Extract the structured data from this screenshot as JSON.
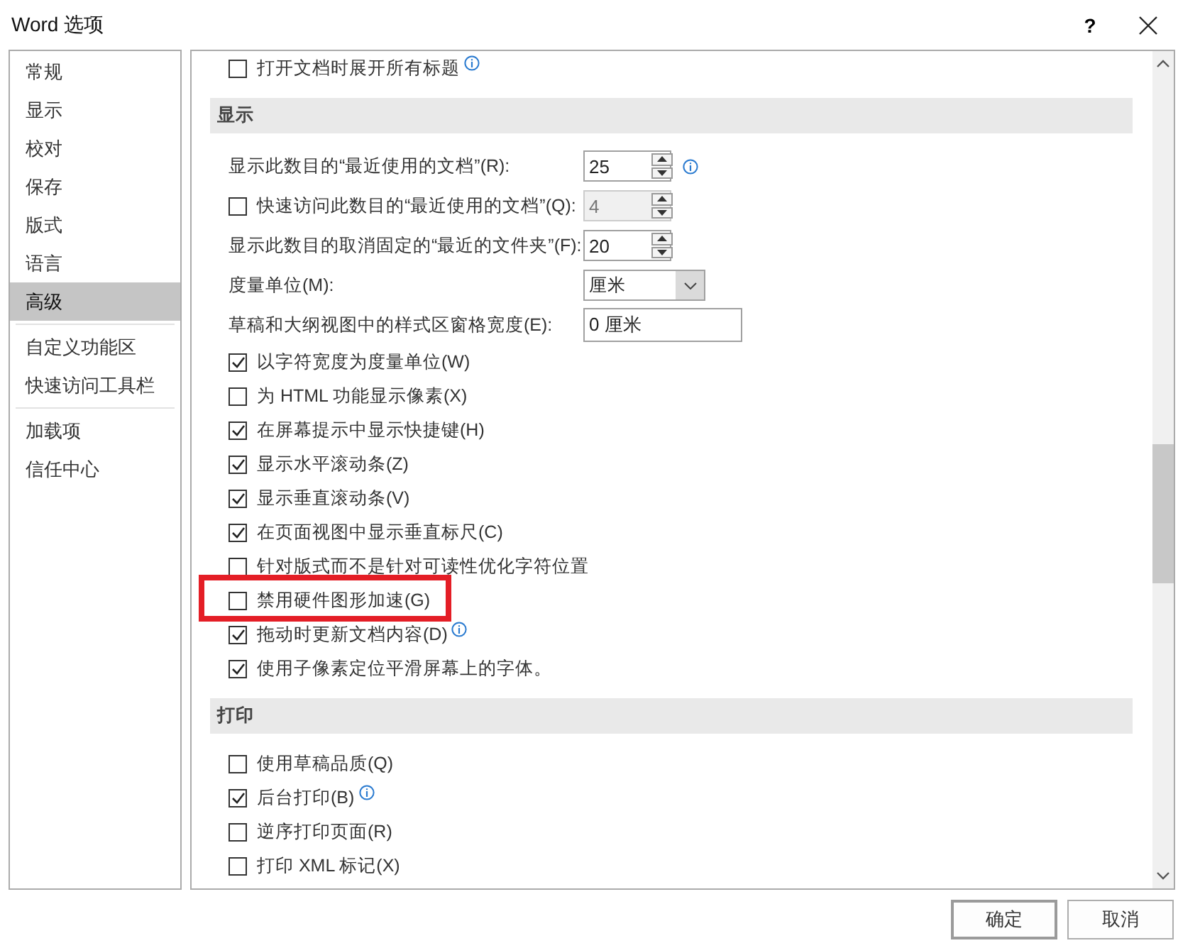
{
  "window": {
    "title": "Word 选项",
    "help": "?"
  },
  "sidebar": {
    "groups": [
      {
        "items": [
          {
            "label": "常规",
            "selected": false
          },
          {
            "label": "显示",
            "selected": false
          },
          {
            "label": "校对",
            "selected": false
          },
          {
            "label": "保存",
            "selected": false
          },
          {
            "label": "版式",
            "selected": false
          },
          {
            "label": "语言",
            "selected": false
          },
          {
            "label": "高级",
            "selected": true
          }
        ]
      },
      {
        "items": [
          {
            "label": "自定义功能区",
            "selected": false
          },
          {
            "label": "快速访问工具栏",
            "selected": false
          }
        ]
      },
      {
        "items": [
          {
            "label": "加载项",
            "selected": false
          },
          {
            "label": "信任中心",
            "selected": false
          }
        ]
      }
    ]
  },
  "sections": [
    {
      "items": [
        {
          "kind": "checkbox",
          "label": "打开文档时展开所有标题",
          "checked": false,
          "info": true
        }
      ]
    },
    {
      "title": "显示",
      "items": [
        {
          "kind": "spinner",
          "label": "显示此数目的“最近使用的文档”(R):",
          "value": "25",
          "info": true
        },
        {
          "kind": "check-spinner",
          "label": "快速访问此数目的“最近使用的文档”(Q):",
          "checked": false,
          "value": "4",
          "disabled": true
        },
        {
          "kind": "spinner",
          "label": "显示此数目的取消固定的“最近的文件夹”(F):",
          "value": "20"
        },
        {
          "kind": "dropdown",
          "label": "度量单位(M):",
          "value": "厘米"
        },
        {
          "kind": "text",
          "label": "草稿和大纲视图中的样式区窗格宽度(E):",
          "value": "0 厘米"
        },
        {
          "kind": "checkbox",
          "label": "以字符宽度为度量单位(W)",
          "checked": true
        },
        {
          "kind": "checkbox",
          "label": "为 HTML 功能显示像素(X)",
          "checked": false
        },
        {
          "kind": "checkbox",
          "label": "在屏幕提示中显示快捷键(H)",
          "checked": true
        },
        {
          "kind": "checkbox",
          "label": "显示水平滚动条(Z)",
          "checked": true
        },
        {
          "kind": "checkbox",
          "label": "显示垂直滚动条(V)",
          "checked": true
        },
        {
          "kind": "checkbox",
          "label": "在页面视图中显示垂直标尺(C)",
          "checked": true
        },
        {
          "kind": "checkbox",
          "label": "针对版式而不是针对可读性优化字符位置",
          "checked": false
        },
        {
          "kind": "checkbox",
          "label": "禁用硬件图形加速(G)",
          "checked": false,
          "highlighted": true
        },
        {
          "kind": "checkbox",
          "label": "拖动时更新文档内容(D)",
          "checked": true,
          "info": true
        },
        {
          "kind": "checkbox",
          "label": "使用子像素定位平滑屏幕上的字体。",
          "checked": true
        }
      ]
    },
    {
      "title": "打印",
      "items": [
        {
          "kind": "checkbox",
          "label": "使用草稿品质(Q)",
          "checked": false
        },
        {
          "kind": "checkbox",
          "label": "后台打印(B)",
          "checked": true,
          "info": true
        },
        {
          "kind": "checkbox",
          "label": "逆序打印页面(R)",
          "checked": false
        },
        {
          "kind": "checkbox",
          "label": "打印 XML 标记(X)",
          "checked": false
        }
      ]
    }
  ],
  "buttons": [
    {
      "label": "确定",
      "default": true
    },
    {
      "label": "取消",
      "default": false
    }
  ]
}
